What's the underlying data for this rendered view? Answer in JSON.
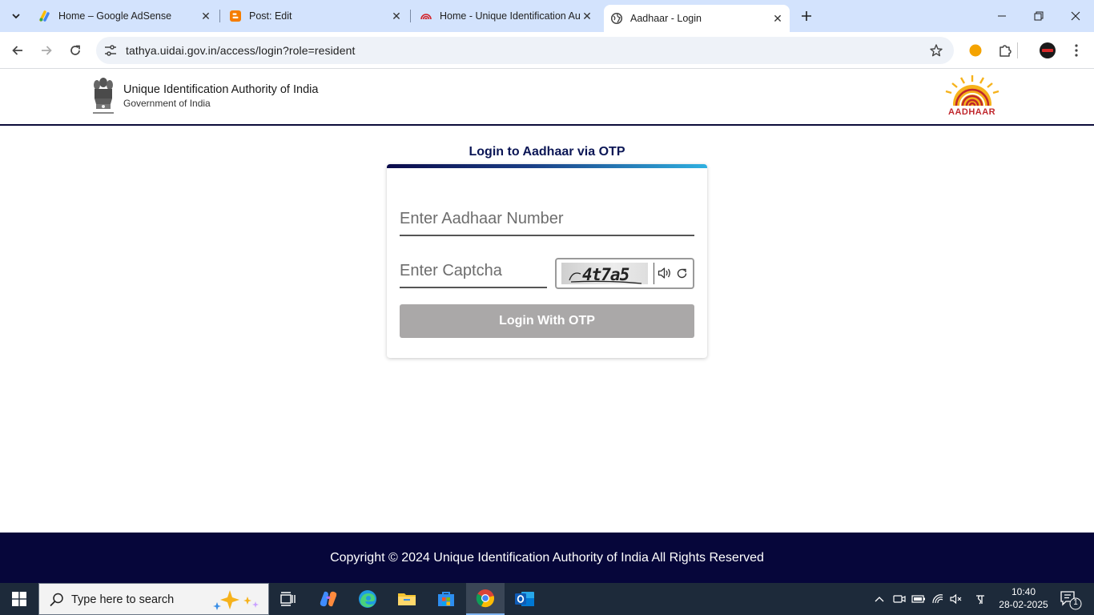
{
  "browser": {
    "tabs": [
      {
        "title": "Home – Google AdSense",
        "favicon": "adsense-icon",
        "active": false
      },
      {
        "title": "Post: Edit",
        "favicon": "blogger-icon",
        "active": false
      },
      {
        "title": "Home - Unique Identification Authority of India",
        "favicon": "aadhaar-fingerprint-icon",
        "active": false
      },
      {
        "title": "Aadhaar - Login",
        "favicon": "globe-icon",
        "active": true
      }
    ],
    "url": "tathya.uidai.gov.in/access/login?role=resident"
  },
  "page": {
    "header": {
      "org_name": "Unique Identification Authority of India",
      "org_sub": "Government of India",
      "logo_text": "AADHAAR"
    },
    "login": {
      "title": "Login to Aadhaar via OTP",
      "aadhaar_placeholder": "Enter Aadhaar Number",
      "captcha_placeholder": "Enter Captcha",
      "captcha_text": "4t7a5",
      "button_label": "Login With OTP"
    },
    "footer": {
      "copyright": "Copyright © 2024 Unique Identification Authority of India All Rights Reserved"
    }
  },
  "taskbar": {
    "search_placeholder": "Type here to search",
    "time": "10:40",
    "date": "28-02-2025",
    "notification_count": "1"
  },
  "colors": {
    "tabstrip_bg": "#d3e3fd",
    "brand_navy": "#0b1655",
    "footer_bg": "#06063a",
    "button_disabled": "#aaa8a8",
    "aadhaar_red": "#c0272d",
    "aadhaar_yellow": "#f6b21b"
  }
}
